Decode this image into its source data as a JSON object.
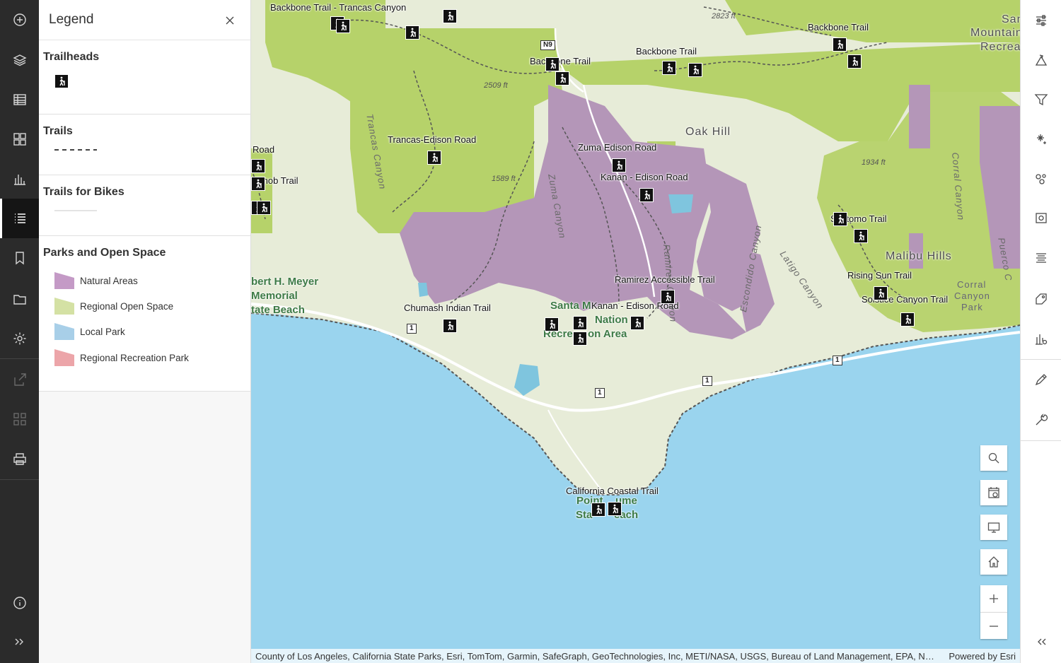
{
  "left_toolbar": {
    "items": [
      {
        "name": "add-data",
        "icon": "plus-circle-icon"
      },
      {
        "name": "layers",
        "icon": "layers-icon"
      },
      {
        "name": "tables",
        "icon": "table-icon"
      },
      {
        "name": "basemap",
        "icon": "basemap-grid-icon"
      },
      {
        "name": "charts",
        "icon": "bar-chart-icon"
      },
      {
        "name": "legend",
        "icon": "legend-list-icon",
        "active": true
      },
      {
        "name": "bookmarks",
        "icon": "bookmark-icon"
      },
      {
        "name": "properties",
        "icon": "folder-icon"
      },
      {
        "name": "settings",
        "icon": "gear-icon"
      },
      {
        "name": "share",
        "icon": "share-icon",
        "disabled": true
      },
      {
        "name": "create-app",
        "icon": "apps-icon",
        "disabled": true
      },
      {
        "name": "print",
        "icon": "printer-icon"
      },
      {
        "name": "about",
        "icon": "info-icon"
      },
      {
        "name": "expand",
        "icon": "chevrons-right-icon"
      }
    ]
  },
  "legend": {
    "title": "Legend",
    "sections": {
      "trailheads": {
        "title": "Trailheads",
        "symbol": "hiker-icon"
      },
      "trails": {
        "title": "Trails",
        "symbol": "dashed-line"
      },
      "bikes": {
        "title": "Trails for Bikes",
        "symbol": "faint-line"
      },
      "parks": {
        "title": "Parks and Open Space",
        "items": [
          {
            "label": "Natural Areas",
            "color": "#c49ac6"
          },
          {
            "label": "Regional Open Space",
            "color": "#d4e1a4"
          },
          {
            "label": "Local Park",
            "color": "#a8cfe8"
          },
          {
            "label": "Regional Recreation Park",
            "color": "#eca5a9"
          }
        ]
      }
    }
  },
  "map": {
    "trail_labels": [
      "Backbone Trail - Trancas Canyon",
      "Backbone Trail",
      "Backbone Trail",
      "Backbone Trail",
      "Trancas-Edison Road",
      "Zuma Edison Road",
      "Kanan - Edison Road",
      "Ramirez Accessible Trail",
      "Kanan - Edison Road",
      "Chumash Indian Trail",
      "Sostomo Trail",
      "Rising Sun Trail",
      "Solstice Canyon Trail",
      "California Coastal Trail",
      "Road",
      "Knob Trail"
    ],
    "place_labels": [
      "Oak Hill",
      "Malibu Hills",
      "Santa",
      "Mountain",
      "Recrea"
    ],
    "park_labels": [
      "bert H. Meyer",
      "Memorial",
      "tate Beach",
      "Santa M",
      "Nation",
      "Recre",
      "on Area",
      "Point",
      "ume",
      "Sta",
      "each"
    ],
    "canyon_labels": [
      "Trancas Canyon",
      "Zuma Canyon",
      "Ramirez Canyon",
      "Escondido Canyon",
      "Latigo Canyon",
      "Corral Canyon",
      "Puerco C"
    ],
    "corral_label": [
      "Corral",
      "Canyon",
      "Park"
    ],
    "elevations": [
      "2823 ft",
      "2509 ft",
      "1589 ft",
      "1934 ft"
    ],
    "highway_shields": [
      "N9",
      "1",
      "1",
      "1",
      "1"
    ],
    "attribution": "County of Los Angeles, California State Parks, Esri, TomTom, Garmin, SafeGraph, GeoTechnologies, Inc, METI/NASA, USGS, Bureau of Land Management, EPA, NPS, USDA",
    "powered_by": "Powered by Esri"
  },
  "map_controls": [
    {
      "name": "search",
      "icon": "search-icon"
    },
    {
      "name": "scale-range",
      "icon": "scale-range-icon"
    },
    {
      "name": "fullscreen",
      "icon": "monitor-icon"
    },
    {
      "name": "home",
      "icon": "home-icon"
    },
    {
      "name": "zoom-in",
      "icon": "plus-icon"
    },
    {
      "name": "zoom-out",
      "icon": "minus-icon"
    }
  ],
  "right_toolbar": {
    "items": [
      {
        "name": "properties",
        "icon": "sliders-icon"
      },
      {
        "name": "styles",
        "icon": "styles-icon"
      },
      {
        "name": "filter",
        "icon": "filter-icon"
      },
      {
        "name": "effects",
        "icon": "sparkle-icon"
      },
      {
        "name": "clustering",
        "icon": "cluster-icon"
      },
      {
        "name": "popups",
        "icon": "popup-icon"
      },
      {
        "name": "fields",
        "icon": "fields-icon"
      },
      {
        "name": "labels",
        "icon": "label-icon"
      },
      {
        "name": "configure-charts",
        "icon": "chart-settings-icon"
      },
      {
        "name": "sketch",
        "icon": "pencil-icon"
      },
      {
        "name": "measure",
        "icon": "wrench-icon"
      },
      {
        "name": "collapse",
        "icon": "chevrons-left-icon"
      }
    ]
  }
}
